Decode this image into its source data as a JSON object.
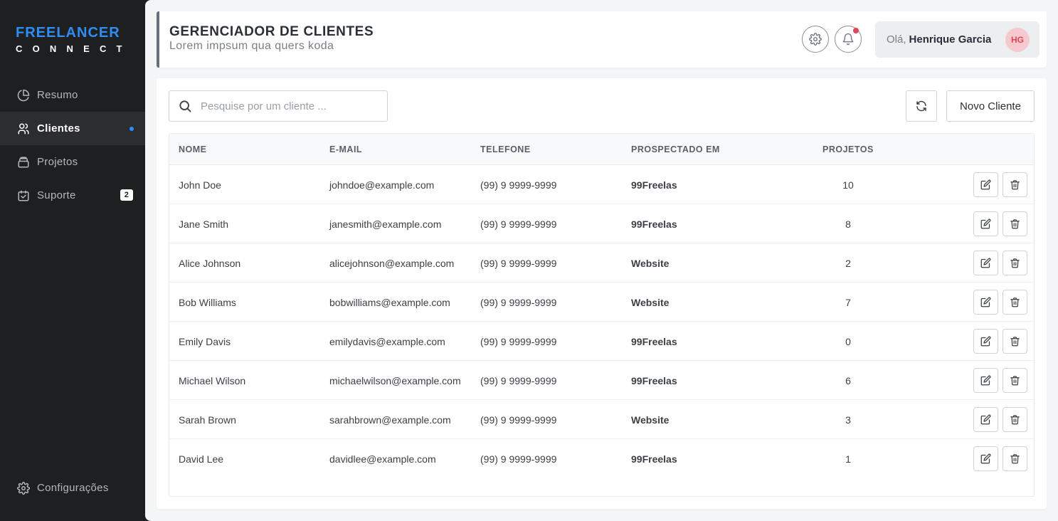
{
  "brand": {
    "line1": "FREELANCER",
    "line2": "CONNECT"
  },
  "sidebar": {
    "items": [
      {
        "label": "Resumo",
        "icon": "pie-chart-icon"
      },
      {
        "label": "Clientes",
        "icon": "users-icon",
        "active": true
      },
      {
        "label": "Projetos",
        "icon": "folder-icon"
      },
      {
        "label": "Suporte",
        "icon": "support-icon",
        "badge": "2"
      }
    ],
    "settings_label": "Configurações"
  },
  "header": {
    "title": "GERENCIADOR DE CLIENTES",
    "subtitle": "Lorem impsum qua quers koda",
    "greeting": "Olá,",
    "user_name": "Henrique Garcia",
    "avatar_initials": "HG"
  },
  "toolbar": {
    "search_placeholder": "Pesquise por um cliente ...",
    "new_client_label": "Novo Cliente"
  },
  "table": {
    "columns": [
      "NOME",
      "E-MAIL",
      "TELEFONE",
      "PROSPECTADO EM",
      "PROJETOS"
    ],
    "rows": [
      {
        "name": "John Doe",
        "email": "johndoe@example.com",
        "phone": "(99) 9 9999-9999",
        "source": "99Freelas",
        "projects": "10"
      },
      {
        "name": "Jane Smith",
        "email": "janesmith@example.com",
        "phone": "(99) 9 9999-9999",
        "source": "99Freelas",
        "projects": "8"
      },
      {
        "name": "Alice Johnson",
        "email": "alicejohnson@example.com",
        "phone": "(99) 9 9999-9999",
        "source": "Website",
        "projects": "2"
      },
      {
        "name": "Bob Williams",
        "email": "bobwilliams@example.com",
        "phone": "(99) 9 9999-9999",
        "source": "Website",
        "projects": "7"
      },
      {
        "name": "Emily Davis",
        "email": "emilydavis@example.com",
        "phone": "(99) 9 9999-9999",
        "source": "99Freelas",
        "projects": "0"
      },
      {
        "name": "Michael Wilson",
        "email": "michaelwilson@example.com",
        "phone": "(99) 9 9999-9999",
        "source": "99Freelas",
        "projects": "6"
      },
      {
        "name": "Sarah Brown",
        "email": "sarahbrown@example.com",
        "phone": "(99) 9 9999-9999",
        "source": "Website",
        "projects": "3"
      },
      {
        "name": "David Lee",
        "email": "davidlee@example.com",
        "phone": "(99) 9 9999-9999",
        "source": "99Freelas",
        "projects": "1"
      }
    ]
  },
  "colors": {
    "accent": "#2f8ef6",
    "sidebar_bg": "#1e1f21",
    "notification": "#e0455a"
  }
}
